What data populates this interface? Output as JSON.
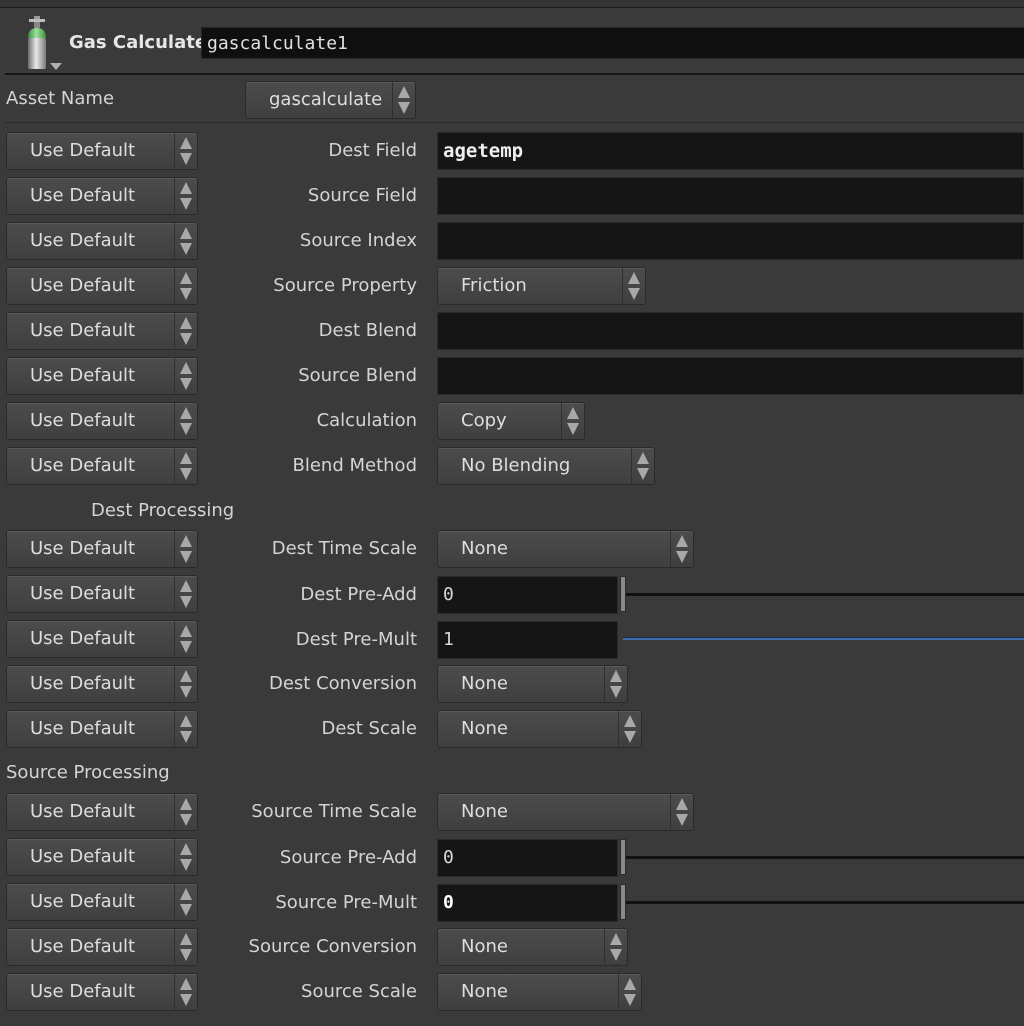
{
  "header": {
    "node_type": "Gas Calculate",
    "node_name": "gascalculate1",
    "icon": "gas-cylinder-icon"
  },
  "asset": {
    "label": "Asset Name",
    "value": "gascalculate"
  },
  "use_default_label": "Use Default",
  "params": [
    {
      "label": "Dest Field",
      "kind": "text",
      "value": "agetemp"
    },
    {
      "label": "Source Field",
      "kind": "text",
      "value": ""
    },
    {
      "label": "Source Index",
      "kind": "text",
      "value": ""
    },
    {
      "label": "Source Property",
      "kind": "menu",
      "value": "Friction"
    },
    {
      "label": "Dest Blend",
      "kind": "text",
      "value": ""
    },
    {
      "label": "Source Blend",
      "kind": "text",
      "value": ""
    },
    {
      "label": "Calculation",
      "kind": "menu",
      "value": "Copy"
    },
    {
      "label": "Blend Method",
      "kind": "menu",
      "value": "No Blending"
    }
  ],
  "dest_processing": {
    "heading": "Dest Processing",
    "params": [
      {
        "label": "Dest Time Scale",
        "kind": "menu",
        "value": "None"
      },
      {
        "label": "Dest Pre-Add",
        "kind": "slider",
        "value": "0"
      },
      {
        "label": "Dest Pre-Mult",
        "kind": "slider",
        "value": "1"
      },
      {
        "label": "Dest Conversion",
        "kind": "menu",
        "value": "None"
      },
      {
        "label": "Dest Scale",
        "kind": "menu",
        "value": "None"
      }
    ]
  },
  "source_processing": {
    "heading": "Source Processing",
    "params": [
      {
        "label": "Source Time Scale",
        "kind": "menu",
        "value": "None"
      },
      {
        "label": "Source Pre-Add",
        "kind": "slider",
        "value": "0"
      },
      {
        "label": "Source Pre-Mult",
        "kind": "slider",
        "value": "0"
      },
      {
        "label": "Source Conversion",
        "kind": "menu",
        "value": "None"
      },
      {
        "label": "Source Scale",
        "kind": "menu",
        "value": "None"
      }
    ]
  }
}
